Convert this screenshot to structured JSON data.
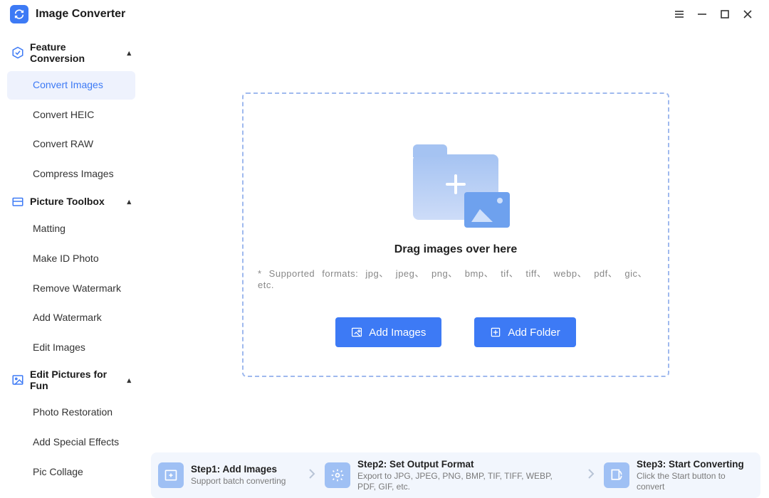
{
  "app": {
    "title": "Image Converter"
  },
  "sidebar": {
    "section1": {
      "label": "Feature Conversion",
      "items": [
        "Convert Images",
        "Convert HEIC",
        "Convert RAW",
        "Compress Images"
      ],
      "active_index": 0
    },
    "section2": {
      "label": "Picture Toolbox",
      "items": [
        "Matting",
        "Make ID Photo",
        "Remove Watermark",
        "Add Watermark",
        "Edit Images"
      ]
    },
    "section3": {
      "label": "Edit Pictures for Fun",
      "items": [
        "Photo Restoration",
        "Add Special Effects",
        "Pic Collage"
      ]
    }
  },
  "drop": {
    "title": "Drag images over here",
    "formats": "* Supported formats: jpg、 jpeg、 png、 bmp、 tif、 tiff、 webp、 pdf、 gic、 etc.",
    "add_images": "Add Images",
    "add_folder": "Add Folder"
  },
  "steps": {
    "s1": {
      "title": "Step1:  Add Images",
      "sub": "Support batch converting"
    },
    "s2": {
      "title": "Step2:  Set Output Format",
      "sub": "Export to JPG, JPEG, PNG, BMP, TIF, TIFF, WEBP, PDF, GIF, etc."
    },
    "s3": {
      "title": "Step3:  Start Converting",
      "sub": "Click the Start button to convert"
    }
  }
}
